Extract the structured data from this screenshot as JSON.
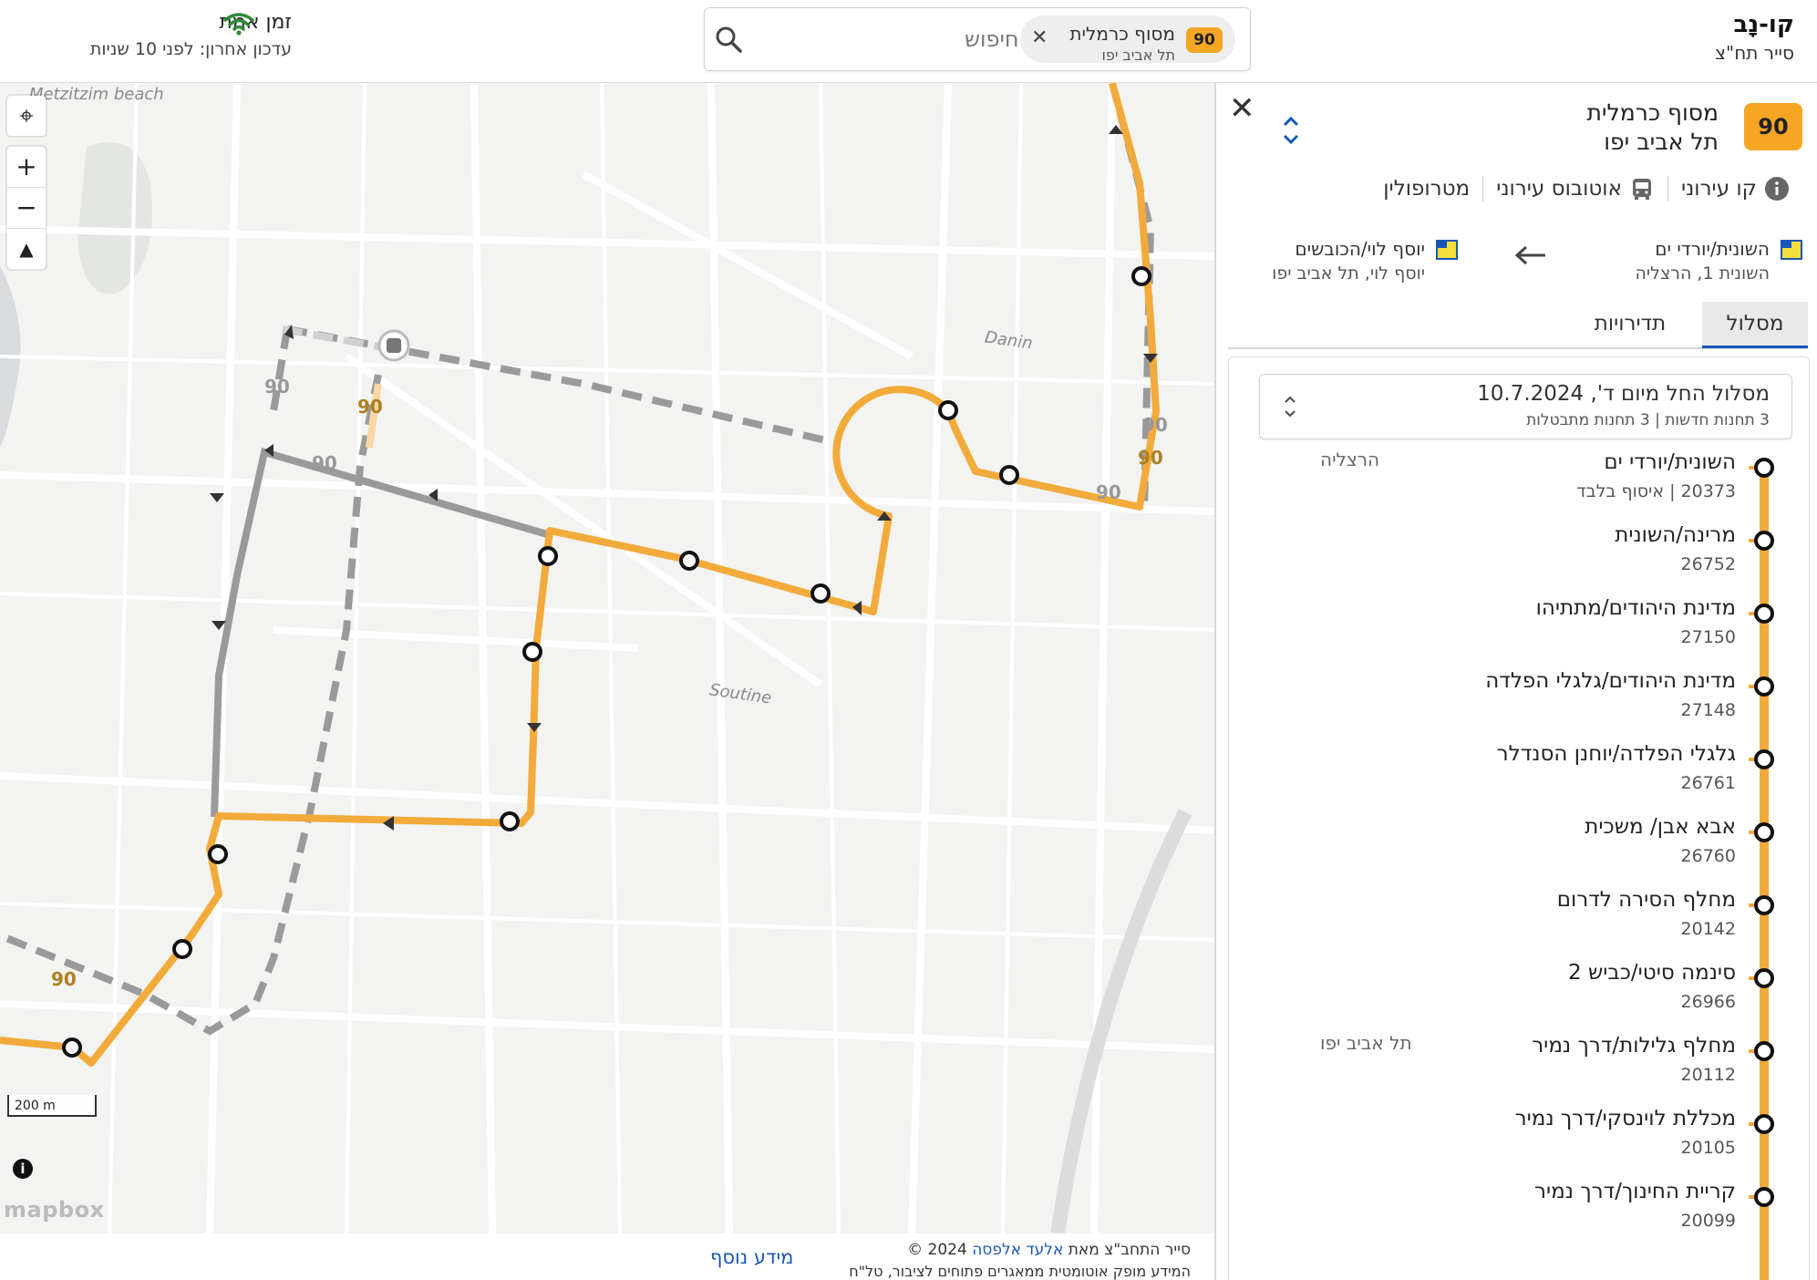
{
  "header": {
    "brand_title": "קו-נָב",
    "brand_subtitle": "סייר תח\"צ",
    "search": {
      "chip_badge": "90",
      "chip_title": "מסוף כרמלית",
      "chip_subtitle": "תל אביב יפו",
      "placeholder": "חיפוש"
    },
    "realtime_title": "זמן אמת",
    "realtime_updated": "עדכון אחרון: לפני 10 שניות"
  },
  "map": {
    "place_labels": [
      "Metzitzim beach",
      "Danin",
      "Soutine"
    ],
    "route_number": "90",
    "scale": "200 m",
    "info": "i",
    "logo": "mapbox",
    "colors": {
      "active_route": "#f2ab3a",
      "other_route": "#9a9a9a",
      "background": "#f3f3f2"
    }
  },
  "footer": {
    "credit_prefix": "סייר התחב\"צ מאת",
    "credit_author": "אלעד אלפסה",
    "credit_year": "2024 ©",
    "note": "המידע מופק אוטומטית ממאגרים פתוחים לציבור, טל\"ח",
    "more_info": "מידע נוסף"
  },
  "panel": {
    "line_badge": "90",
    "line_title": "מסוף כרמלית",
    "line_subtitle": "תל אביב יפו",
    "tags": [
      "קו עירוני",
      "אוטובוס עירוני",
      "מטרופולין"
    ],
    "from_name": "השונית/יורדי ים",
    "from_address": "השונית 1, הרצליה",
    "to_name": "יוסף לוי/הכובשים",
    "to_address": "יוסף לוי, תל אביב יפו",
    "tabs": [
      "מסלול",
      "תדירויות"
    ],
    "route_select_title": "מסלול החל מיום ד', 10.7.2024",
    "route_select_sub": "3 תחנות חדשות | 3 תחנות מתבטלות",
    "stops": [
      {
        "name": "השונית/יורדי ים",
        "code": "20373 | איסוף בלבד",
        "city": "הרצליה"
      },
      {
        "name": "מרינה/השונית",
        "code": "26752",
        "city": ""
      },
      {
        "name": "מדינת היהודים/מתתיהו",
        "code": "27150",
        "city": ""
      },
      {
        "name": "מדינת היהודים/גלגלי הפלדה",
        "code": "27148",
        "city": ""
      },
      {
        "name": "גלגלי הפלדה/יוחנן הסנדלר",
        "code": "26761",
        "city": ""
      },
      {
        "name": "אבא אבן/ משכית",
        "code": "26760",
        "city": ""
      },
      {
        "name": "מחלף הסירה לדרום",
        "code": "20142",
        "city": ""
      },
      {
        "name": "סינמה סיטי/כביש 2",
        "code": "26966",
        "city": ""
      },
      {
        "name": "מחלף גלילות/דרך נמיר",
        "code": "20112",
        "city": "תל אביב יפו"
      },
      {
        "name": "מכללת לוינסקי/דרך נמיר",
        "code": "20105",
        "city": ""
      },
      {
        "name": "קריית החינוך/דרך נמיר",
        "code": "20099",
        "city": ""
      }
    ]
  }
}
